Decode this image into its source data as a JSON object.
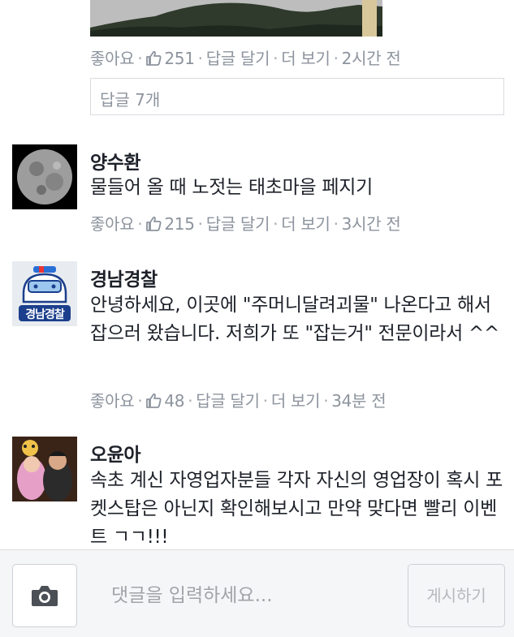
{
  "comments_top": {
    "meta": {
      "like": "좋아요",
      "count": "251",
      "reply": "답글 달기",
      "more": "더 보기",
      "time": "2시간 전"
    },
    "replies_label": "답글 7개"
  },
  "comments": [
    {
      "author": "양수환",
      "text": "물들어 올 때 노젓는 태초마을 페지기",
      "meta": {
        "like": "좋아요",
        "count": "215",
        "reply": "답글 달기",
        "more": "더 보기",
        "time": "3시간 전"
      }
    },
    {
      "author": "경남경찰",
      "avatar_text": "경남경찰",
      "text": "안녕하세요, 이곳에 \"주머니달려괴물\" 나온다고 해서 잡으러 왔습니다. 저희가 또 \"잡는거\" 전문이라서 ^^",
      "meta": {
        "like": "좋아요",
        "count": "48",
        "reply": "답글 달기",
        "more": "더 보기",
        "time": "34분 전"
      }
    },
    {
      "author": "오윤아",
      "text": "속초 계신 자영업자분들 각자 자신의 영업장이 혹시 포켓스탑은 아닌지 확인해보시고 만약 맞다면 빨리 이벤트 ㄱㄱ!!!"
    }
  ],
  "input_bar": {
    "placeholder": "댓글을 입력하세요...",
    "post_label": "게시하기"
  },
  "colors": {
    "meta_text": "#8d949e",
    "body_text": "#1d2129",
    "like_icon": "#8d949e",
    "input_bg": "#f5f6f7"
  }
}
